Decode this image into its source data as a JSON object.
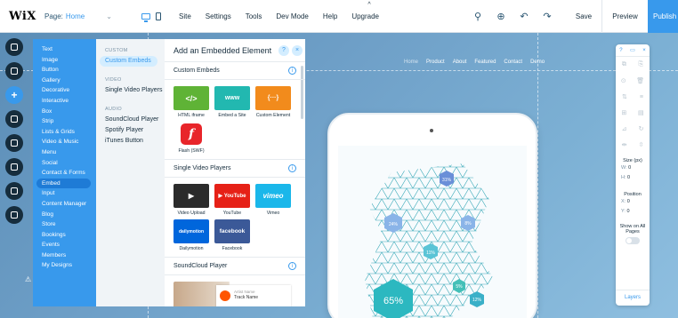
{
  "topbar": {
    "logo": "WiX",
    "page_label": "Page:",
    "page_value": "Home",
    "menu": [
      "Site",
      "Settings",
      "Tools",
      "Dev Mode",
      "Help",
      "Upgrade"
    ],
    "save": "Save",
    "preview": "Preview",
    "publish": "Publish"
  },
  "site_nav": [
    "Home",
    "Product",
    "About",
    "Featured",
    "Contact",
    "Demo"
  ],
  "categories": [
    "Text",
    "Image",
    "Button",
    "Gallery",
    "Decorative",
    "Interactive",
    "Box",
    "Strip",
    "Lists & Grids",
    "Video & Music",
    "Menu",
    "Social",
    "Contact & Forms",
    "Embed",
    "Input",
    "Content Manager",
    "Blog",
    "Store",
    "Bookings",
    "Events",
    "Members",
    "My Designs"
  ],
  "active_category": "Embed",
  "subcats": {
    "custom_header": "CUSTOM",
    "custom_items": [
      "Custom Embeds"
    ],
    "video_header": "VIDEO",
    "video_items": [
      "Single Video Players"
    ],
    "audio_header": "AUDIO",
    "audio_items": [
      "SoundCloud Player",
      "Spotify Player",
      "iTunes Button"
    ]
  },
  "panel": {
    "title": "Add an Embedded Element",
    "help": "?",
    "close": "×",
    "sections": {
      "custom": {
        "title": "Custom Embeds",
        "tiles": [
          {
            "label": "HTML iframe",
            "glyph": "</>",
            "color": "#5fb336"
          },
          {
            "label": "Embed a Site",
            "glyph": "www",
            "color": "#22b8b0"
          },
          {
            "label": "Custom Element",
            "glyph": "{···}",
            "color": "#f28b1c"
          }
        ],
        "tiles2": [
          {
            "label": "Flash (SWF)",
            "glyph": "f",
            "color": "#e8252a"
          }
        ]
      },
      "video": {
        "title": "Single Video Players",
        "tiles": [
          {
            "label": "Video Upload",
            "glyph": "▶",
            "color": "#2b2b2b"
          },
          {
            "label": "YouTube",
            "glyph": "▶ YouTube",
            "color": "#e62117"
          },
          {
            "label": "Vimeo",
            "glyph": "vimeo",
            "color": "#1ab7ea"
          }
        ],
        "tiles2": [
          {
            "label": "Dailymotion",
            "glyph": "dailymotion",
            "color": "#0066dc"
          },
          {
            "label": "Facebook",
            "glyph": "facebook",
            "color": "#3b5998"
          }
        ]
      },
      "soundcloud": {
        "title": "SoundCloud Player",
        "artist": "Artist Name",
        "track": "Track Name"
      }
    }
  },
  "tablet_stats": [
    "31%",
    "24%",
    "8%",
    "11%",
    "5%",
    "12%",
    "65%"
  ],
  "right_panel": {
    "size_label": "Size (px)",
    "w_label": "W:",
    "w_value": "0",
    "h_label": "H:",
    "h_value": "0",
    "position_label": "Position",
    "x_label": "X:",
    "x_value": "0",
    "y_label": "Y:",
    "y_value": "0",
    "show_all_pages": "Show on All Pages",
    "layers": "Layers"
  }
}
